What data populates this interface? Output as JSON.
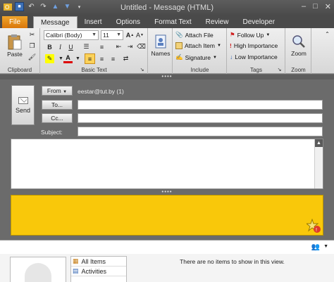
{
  "window": {
    "title": "Untitled  -  Message (HTML)"
  },
  "tabs": [
    {
      "label": "File"
    },
    {
      "label": "Message"
    },
    {
      "label": "Insert"
    },
    {
      "label": "Options"
    },
    {
      "label": "Format Text"
    },
    {
      "label": "Review"
    },
    {
      "label": "Developer"
    }
  ],
  "ribbon": {
    "clipboard": {
      "paste": "Paste",
      "label": "Clipboard"
    },
    "basic_text": {
      "font": "Calibri (Body)",
      "size": "11",
      "label": "Basic Text"
    },
    "names": {
      "label": "Names"
    },
    "include": {
      "attach_file": "Attach File",
      "attach_item": "Attach Item",
      "signature": "Signature",
      "label": "Include"
    },
    "tags": {
      "follow_up": "Follow Up",
      "high": "High Importance",
      "low": "Low Importance",
      "label": "Tags"
    },
    "zoom": {
      "button": "Zoom",
      "label": "Zoom"
    }
  },
  "compose": {
    "send": "Send",
    "from_btn": "From",
    "from_value": "eestar@tut.by (1)",
    "to_btn": "To...",
    "cc_btn": "Cc...",
    "subject_label": "Subject:",
    "to_value": "",
    "cc_value": "",
    "subject_value": ""
  },
  "people_pane": {
    "items": [
      {
        "label": "All Items"
      },
      {
        "label": "Activities"
      }
    ],
    "empty_message": "There are no items to show in this view."
  },
  "colors": {
    "people_pane_yellow": "#f9c80a",
    "file_tab": "#e58a17"
  }
}
